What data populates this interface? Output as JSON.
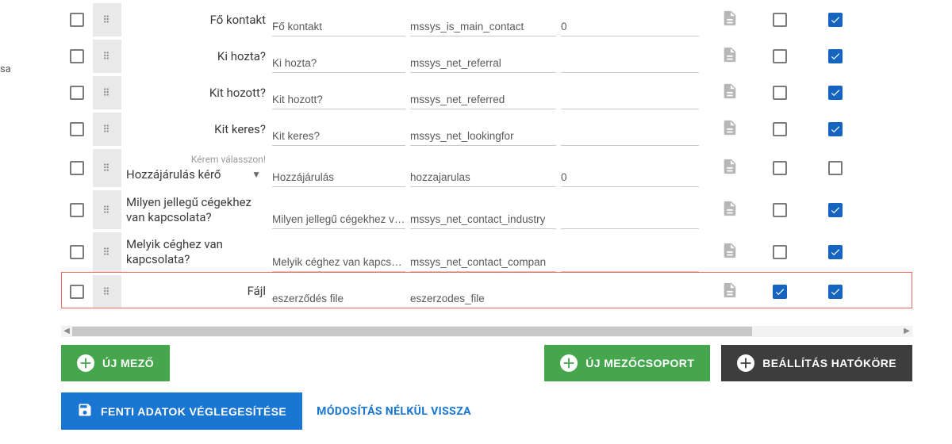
{
  "sidebar_stub": "sa",
  "rows": [
    {
      "label": "Fő kontakt",
      "hint": "",
      "select": false,
      "f1": "Fő kontakt",
      "f2": "mssys_is_main_contact",
      "f3": "0",
      "cb1": false,
      "cb2": true,
      "highlight": false
    },
    {
      "label": "Ki hozta?",
      "hint": "",
      "select": false,
      "f1": "Ki hozta?",
      "f2": "mssys_net_referral",
      "f3": "",
      "cb1": false,
      "cb2": true,
      "highlight": false
    },
    {
      "label": "Kit hozott?",
      "hint": "",
      "select": false,
      "f1": "Kit hozott?",
      "f2": "mssys_net_referred",
      "f3": "",
      "cb1": false,
      "cb2": true,
      "highlight": false
    },
    {
      "label": "Kit keres?",
      "hint": "",
      "select": false,
      "f1": "Kit keres?",
      "f2": "mssys_net_lookingfor",
      "f3": "",
      "cb1": false,
      "cb2": true,
      "highlight": false
    },
    {
      "label": "Hozzájárulás kérő",
      "hint": "Kérem válasszon!",
      "select": true,
      "f1": "Hozzájárulás",
      "f2": "hozzajarulas",
      "f3": "0",
      "cb1": false,
      "cb2": false,
      "highlight": false
    },
    {
      "label": "Milyen jellegű cégekhez van kapcsolata?",
      "hint": "",
      "select": false,
      "f1": "Milyen jellegű cégekhez van",
      "f2": "mssys_net_contact_industry",
      "f3": "",
      "cb1": false,
      "cb2": true,
      "highlight": false
    },
    {
      "label": "Melyik céghez van kapcsolata?",
      "hint": "",
      "select": false,
      "f1": "Melyik céghez van kapcsolat",
      "f2": "mssys_net_contact_compan",
      "f3": "",
      "cb1": false,
      "cb2": true,
      "highlight": false
    },
    {
      "label": "Fájl",
      "hint": "",
      "select": false,
      "f1": "eszerződés file",
      "f2": "eszerzodes_file",
      "f3": "",
      "cb1": true,
      "cb2": true,
      "highlight": true
    }
  ],
  "buttons": {
    "new_field": "ÚJ MEZŐ",
    "new_group": "ÚJ MEZŐCSOPORT",
    "scope": "BEÁLLÍTÁS HATÓKÖRE",
    "finalize": "FENTI ADATOK VÉGLEGESÍTÉSE",
    "back": "MÓDOSÍTÁS NÉLKÜL VISSZA"
  }
}
